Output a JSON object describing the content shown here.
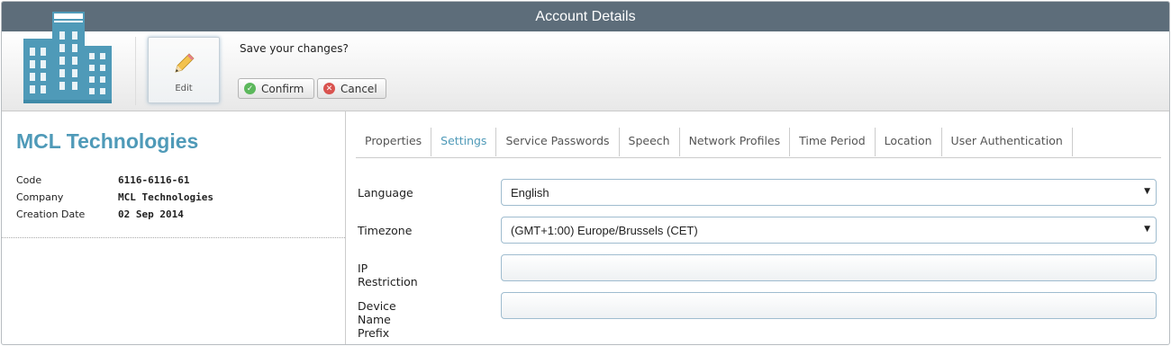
{
  "window": {
    "title": "Account Details"
  },
  "toolbar": {
    "edit_label": "Edit",
    "save_prompt": "Save your changes?",
    "confirm_label": "Confirm",
    "cancel_label": "Cancel"
  },
  "account": {
    "name": "MCL Technologies",
    "details": [
      {
        "label": "Code",
        "value": "6116-6116-61"
      },
      {
        "label": "Company",
        "value": "MCL Technologies"
      },
      {
        "label": "Creation Date",
        "value": "02 Sep 2014"
      }
    ]
  },
  "tabs": [
    {
      "label": "Properties"
    },
    {
      "label": "Settings"
    },
    {
      "label": "Service Passwords"
    },
    {
      "label": "Speech"
    },
    {
      "label": "Network Profiles"
    },
    {
      "label": "Time Period"
    },
    {
      "label": "Location"
    },
    {
      "label": "User Authentication"
    }
  ],
  "active_tab": "Settings",
  "settings": {
    "language_label": "Language",
    "language_value": "English",
    "timezone_label": "Timezone",
    "timezone_value": "(GMT+1:00) Europe/Brussels (CET)",
    "ip_label": "IP Restriction",
    "ip_value": "",
    "prefix_label": "Device Name Prefix",
    "prefix_value": ""
  },
  "colors": {
    "titlebar": "#5d6d7a",
    "accent": "#4f9ab8",
    "confirm_icon": "#5cb85c",
    "cancel_icon": "#d9534f"
  },
  "icons": {
    "building": "building-icon",
    "edit": "pencil-icon",
    "confirm": "check-circle-icon",
    "cancel": "x-circle-icon",
    "dropdown": "caret-down-icon"
  }
}
